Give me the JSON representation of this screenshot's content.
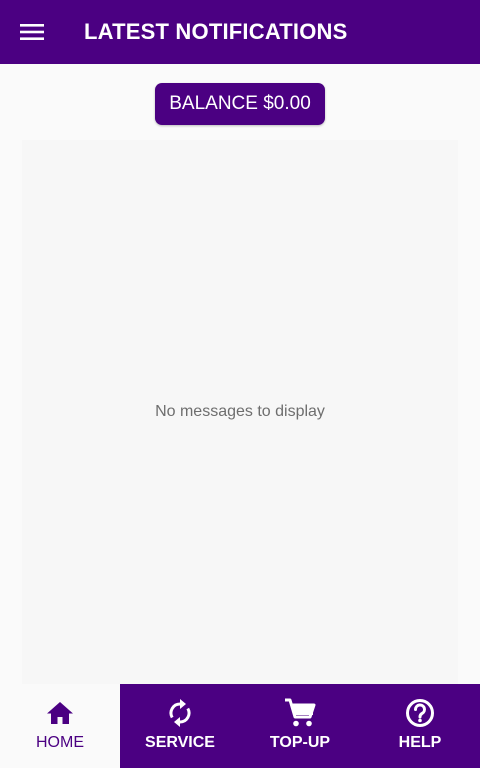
{
  "appbar": {
    "title": "LATEST NOTIFICATIONS",
    "menu_icon": "menu-icon"
  },
  "balance": {
    "label": "BALANCE $0.00"
  },
  "notifications": {
    "empty_message": "No messages to display"
  },
  "bottom_nav": {
    "items": [
      {
        "label": "HOME",
        "icon": "home-icon",
        "active": true
      },
      {
        "label": "SERVICE",
        "icon": "refresh-icon",
        "active": false
      },
      {
        "label": "TOP-UP",
        "icon": "cart-icon",
        "active": false
      },
      {
        "label": "HELP",
        "icon": "help-icon",
        "active": false
      }
    ]
  },
  "colors": {
    "primary": "#4b0082",
    "background": "#fafafa",
    "on_primary": "#ffffff",
    "muted_text": "#6e6e6e"
  }
}
